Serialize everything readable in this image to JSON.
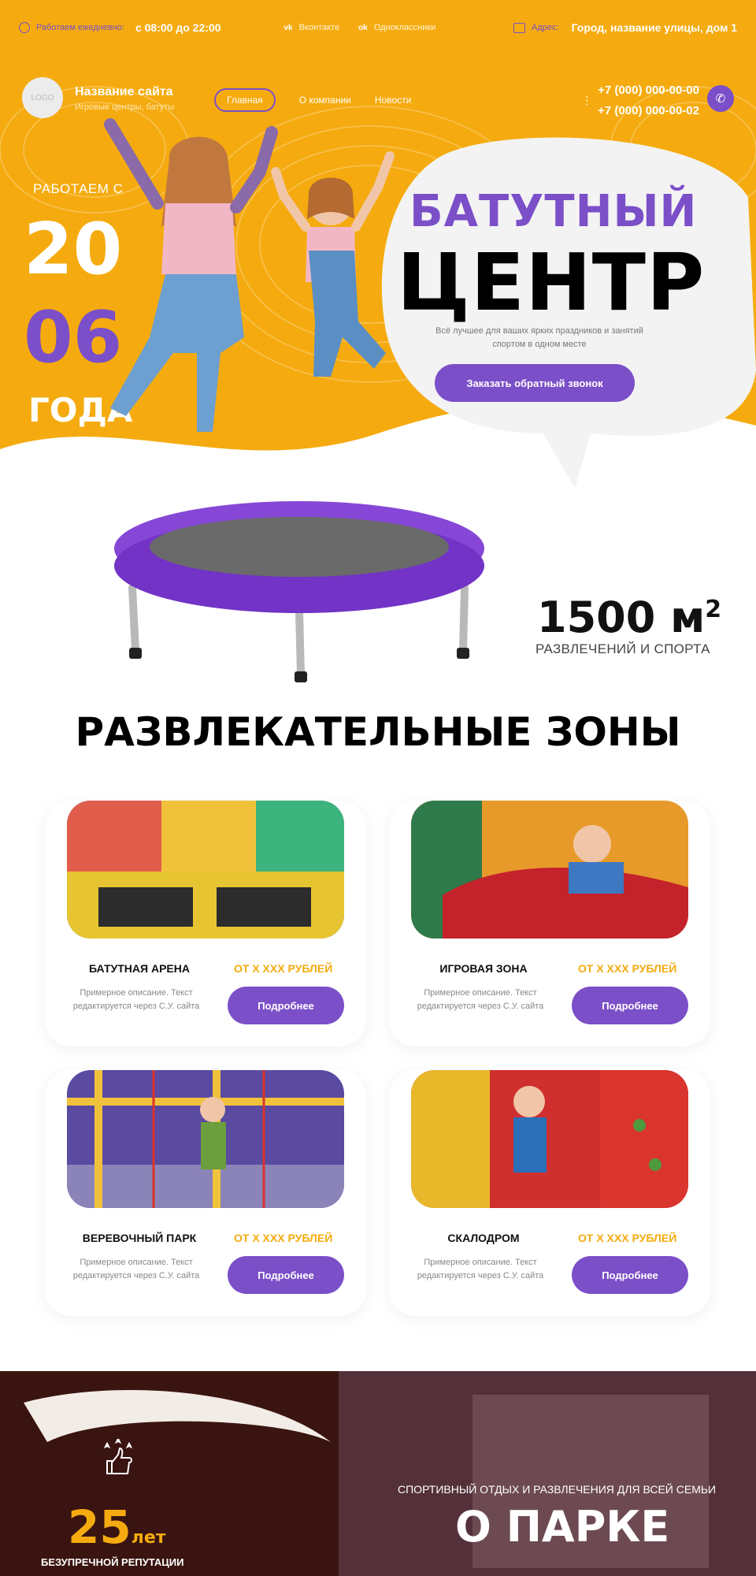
{
  "topbar": {
    "hours_label": "Работаем ежедневно:",
    "hours_value": "с 08:00 до 22:00",
    "social": [
      {
        "icon": "vk-icon",
        "label": "Вконтакте"
      },
      {
        "icon": "ok-icon",
        "label": "Одноклассники"
      }
    ],
    "address_label": "Адрес:",
    "address_value": "Город, название улицы, дом 1"
  },
  "header": {
    "logo": "LOGO",
    "site_name": "Название сайта",
    "site_sub": "Игровые центры, батуты",
    "nav": [
      "Главная",
      "О компании",
      "Новости"
    ],
    "more": "⋮",
    "phones": [
      "+7 (000) 000-00-00",
      "+7 (000) 000-00-02"
    ]
  },
  "hero": {
    "since_label": "РАБОТАЕМ С",
    "year_part1": "20",
    "year_part2": "06",
    "year_suffix": "ГОДА",
    "title1": "БАТУТНЫЙ",
    "title2": "ЦЕНТР",
    "description": "Всё лучшее для ваших ярких праздников и занятий спортом в одном месте",
    "cta": "Заказать обратный звонок",
    "area_value": "1500 м",
    "area_sup": "2",
    "area_sub": "РАЗВЛЕЧЕНИЙ И СПОРТА"
  },
  "zones": {
    "title": "РАЗВЛЕКАТЕЛЬНЫЕ ЗОНЫ",
    "items": [
      {
        "name": "БАТУТНАЯ АРЕНА",
        "price": "ОТ X XXX РУБЛЕЙ",
        "desc": "Примерное описание. Текст редактируется через С.У. сайта",
        "button": "Подробнее"
      },
      {
        "name": "ИГРОВАЯ ЗОНА",
        "price": "ОТ X XXX РУБЛЕЙ",
        "desc": "Примерное описание. Текст редактируется через С.У. сайта",
        "button": "Подробнее"
      },
      {
        "name": "ВЕРЕВОЧНЫЙ ПАРК",
        "price": "ОТ X XXX РУБЛЕЙ",
        "desc": "Примерное описание. Текст редактируется через С.У. сайта",
        "button": "Подробнее"
      },
      {
        "name": "СКАЛОДРОМ",
        "price": "ОТ X XXX РУБЛЕЙ",
        "desc": "Примерное описание. Текст редактируется через С.У. сайта",
        "button": "Подробнее"
      }
    ]
  },
  "about": {
    "reputation_number": "25",
    "reputation_unit": "лет",
    "reputation_label": "БЕЗУПРЕЧНОЙ РЕПУТАЦИИ",
    "kicker": "СПОРТИВНЫЙ ОТДЫХ И РАЗВЛЕЧЕНИЯ ДЛЯ ВСЕЙ СЕМЬИ",
    "title": "О ПАРКЕ"
  },
  "colors": {
    "accent_yellow": "#f5ab0f",
    "accent_purple": "#7b4fc8"
  }
}
